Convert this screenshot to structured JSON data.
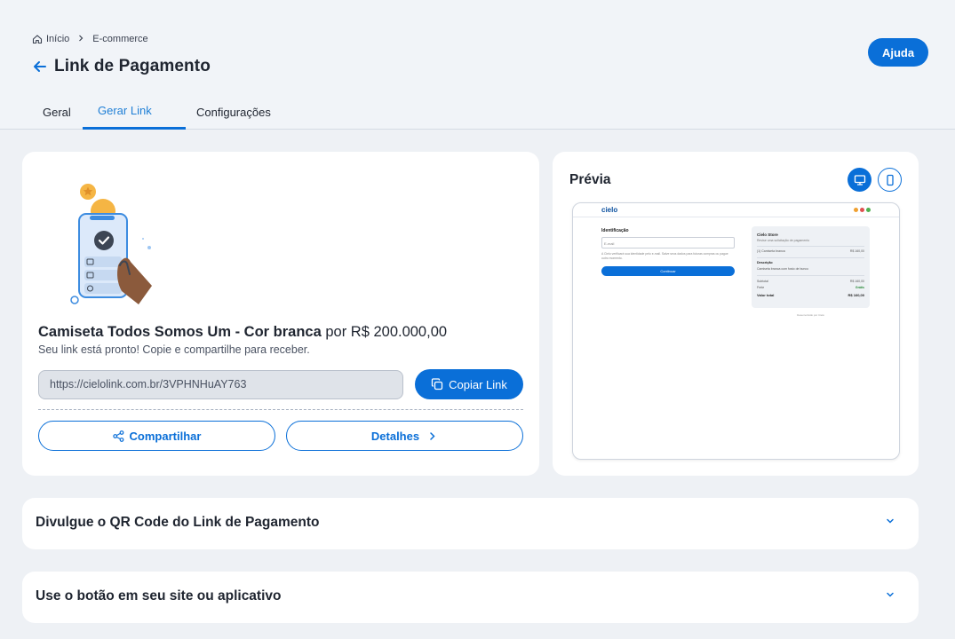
{
  "breadcrumb": {
    "home_icon": "home-icon",
    "home": "Início",
    "current": "E-commerce"
  },
  "header": {
    "title": "Link de Pagamento",
    "help_label": "Ajuda"
  },
  "tabs": [
    {
      "label": "Geral",
      "active": false
    },
    {
      "label": "Gerar Link",
      "active": true
    },
    {
      "label": "Configurações",
      "active": false
    }
  ],
  "link_card": {
    "product_name": "Camiseta Todos Somos Um - Cor branca",
    "price_text": "por R$ 200.000,00",
    "subtitle": "Seu link está pronto! Copie e compartilhe para receber.",
    "url": "https://cielolink.com.br/3VPHNHuAY763",
    "copy_label": "Copiar Link",
    "share_label": "Compartilhar",
    "details_label": "Detalhes"
  },
  "preview": {
    "title": "Prévia",
    "selected_device": "desktop",
    "frame": {
      "logo": "cielo",
      "identification": "Identificação",
      "email_placeholder": "E-mail",
      "note": "A Cielo verificará sua identidade pelo e-mail. Salve seus dados para futuras compras ou pague outro momento.",
      "continue_label": "Continuar",
      "store_name": "Cielo Store",
      "store_sub": "Revise uma solicitação de pagamento",
      "item_name": "(1) Camiseta branca",
      "item_price": "R$ 160,00",
      "description_label": "Descrição",
      "description_text": "Camiseta branca com fosto de bunco",
      "subtotal_label": "Subtotal",
      "subtotal_value": "R$ 160,00",
      "freight_label": "Frete",
      "freight_value": "Grátis",
      "total_label": "Valor total",
      "total_value": "R$ 160,00",
      "footer": "Desenvolvido por Cielo"
    }
  },
  "accordions": [
    {
      "title": "Divulgue o QR Code do Link de Pagamento"
    },
    {
      "title": "Use o botão em seu site ou aplicativo"
    }
  ],
  "colors": {
    "primary": "#0a6fd8",
    "background": "#eef1f5",
    "card": "#ffffff",
    "text": "#1f2530"
  }
}
